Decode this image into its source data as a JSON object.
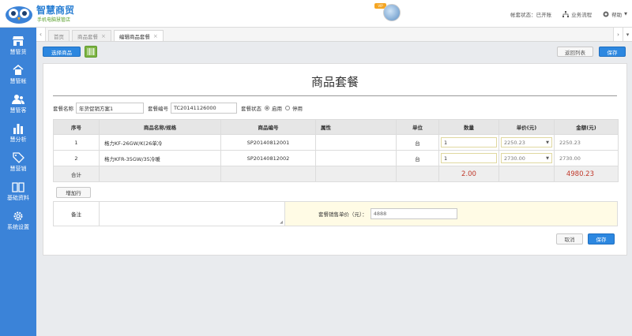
{
  "brand": {
    "name": "智慧商贸",
    "subtitle": "手机电脑慧管店",
    "vip_badge": "VIP"
  },
  "header": {
    "account_status": "帐套状态：已开账",
    "workflow": "业务流程",
    "help": "帮助"
  },
  "sidebar": {
    "items": [
      {
        "label": "慧管货",
        "icon": "store-icon"
      },
      {
        "label": "慧管帐",
        "icon": "ledger-icon"
      },
      {
        "label": "慧管客",
        "icon": "customers-icon"
      },
      {
        "label": "慧分析",
        "icon": "bar-chart-icon"
      },
      {
        "label": "慧营销",
        "icon": "tag-icon"
      },
      {
        "label": "基础资料",
        "icon": "book-icon"
      },
      {
        "label": "系统设置",
        "icon": "gear-icon"
      }
    ]
  },
  "tabs": [
    {
      "label": "首页",
      "closable": false
    },
    {
      "label": "商品套餐",
      "closable": true
    },
    {
      "label": "编辑商品套餐",
      "closable": true,
      "active": true
    }
  ],
  "toolbar": {
    "select_product": "选择商品",
    "back_to_list": "返回列表",
    "save": "保存"
  },
  "page": {
    "title": "商品套餐"
  },
  "form": {
    "name_label": "套餐名称",
    "name_value": "年货促销方案1",
    "code_label": "套餐编号",
    "code_value": "TC20141126000",
    "status_label": "套餐状态",
    "status_enabled": "启用",
    "status_disabled": "停用"
  },
  "table": {
    "headers": [
      "序号",
      "商品名称/规格",
      "商品编号",
      "属性",
      "单位",
      "数量",
      "单价(元)",
      "金额(元)"
    ],
    "rows": [
      {
        "no": "1",
        "name": "格力KF-26GW/K(26单冷",
        "code": "SP20140812001",
        "attr": "",
        "unit": "台",
        "qty": "1",
        "price": "2250.23",
        "amount": "2250.23"
      },
      {
        "no": "2",
        "name": "格力KFR-35GW/35冷暖",
        "code": "SP20140812002",
        "attr": "",
        "unit": "台",
        "qty": "1",
        "price": "2730.00",
        "amount": "2730.00"
      }
    ],
    "summary": {
      "label": "合计",
      "qty": "2.00",
      "amount": "4980.23"
    }
  },
  "add_row": "增加行",
  "remark": {
    "label": "备注",
    "value": "",
    "price_label": "套餐销售单价（元）：",
    "price_value": "4888"
  },
  "footer": {
    "cancel": "取消",
    "save": "保存"
  },
  "colors": {
    "primary": "#2c87e0",
    "sidebar": "#3b83d8",
    "total_red": "#c0392b"
  }
}
